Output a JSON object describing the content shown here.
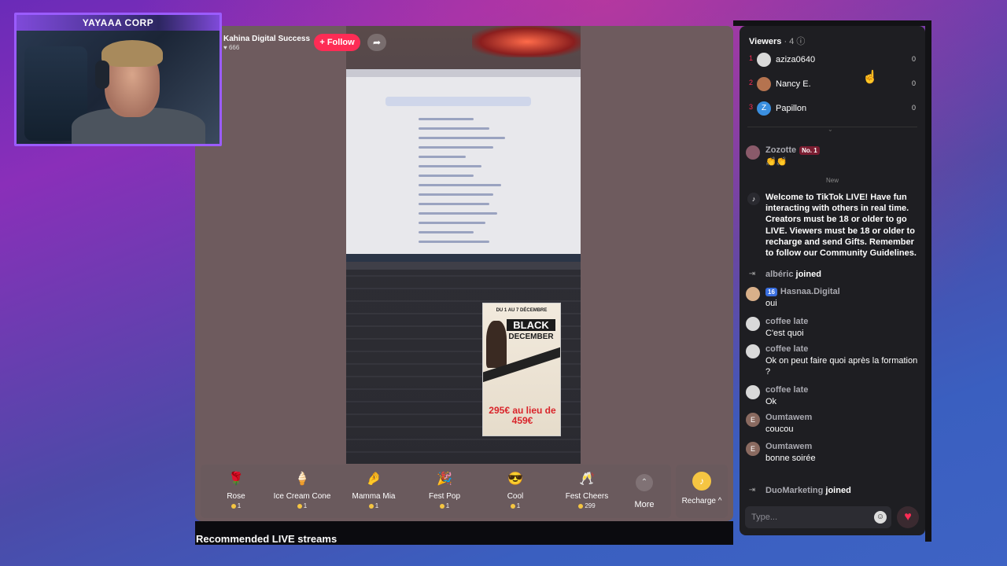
{
  "webcam": {
    "title": "YAYAAA CORP"
  },
  "streamer": {
    "name": "Kahina Digital Success",
    "likes": "666",
    "follow_label": "+ Follow",
    "share_icon": "share-icon"
  },
  "stream_poster": {
    "top": "DU 1 AU 7 DÉCEMBRE",
    "line1": "BLACK",
    "line2": "DECEMBER",
    "price": "295€ au lieu de 459€"
  },
  "gifts": [
    {
      "name": "Rose",
      "price": "1",
      "icon": "rose-icon"
    },
    {
      "name": "Ice Cream Cone",
      "price": "1",
      "icon": "ice-cream-icon"
    },
    {
      "name": "Mamma Mia",
      "price": "1",
      "icon": "mamma-mia-icon"
    },
    {
      "name": "Fest Pop",
      "price": "1",
      "icon": "fest-pop-icon"
    },
    {
      "name": "Cool",
      "price": "1",
      "icon": "sunglasses-icon"
    },
    {
      "name": "Fest Cheers",
      "price": "299",
      "icon": "fest-cheers-icon"
    }
  ],
  "more_label": "More",
  "recharge_label": "Recharge ^",
  "recommended_title": "Recommended LIVE streams",
  "viewers": {
    "title": "Viewers",
    "count": "· 4",
    "list": [
      {
        "rank": "1",
        "name": "aziza0640",
        "score": "0",
        "initial": ""
      },
      {
        "rank": "2",
        "name": "Nancy E.",
        "score": "0",
        "initial": ""
      },
      {
        "rank": "3",
        "name": "Papillon",
        "score": "0",
        "initial": "Z"
      }
    ]
  },
  "top_gifter": {
    "name": "Zozotte",
    "badge": "No. 1",
    "text": "👏👏"
  },
  "new_label": "New",
  "system_message": "Welcome to TikTok LIVE! Have fun interacting with others in real time. Creators must be 18 or older to go LIVE. Viewers must be 18 or older to recharge and send Gifts. Remember to follow our Community Guidelines.",
  "chat": [
    {
      "type": "join",
      "user": "albéric",
      "text": "joined"
    },
    {
      "type": "msg",
      "user": "Hasnaa.Digital",
      "badge": "16",
      "text": "oui"
    },
    {
      "type": "msg",
      "user": "coffee late",
      "text": "C'est quoi"
    },
    {
      "type": "msg",
      "user": "coffee late",
      "text": "Ok on peut faire quoi après la formation ?"
    },
    {
      "type": "msg",
      "user": "coffee late",
      "text": "Ok"
    },
    {
      "type": "msg",
      "user": "Oumtawem",
      "initial": "E",
      "text": "coucou"
    },
    {
      "type": "msg",
      "user": "Oumtawem",
      "initial": "E",
      "text": "bonne soirée"
    },
    {
      "type": "join",
      "user": "DuoMarketing",
      "text": "joined"
    }
  ],
  "input": {
    "placeholder": "Type..."
  },
  "colors": {
    "accent": "#fe2c55",
    "panel": "#1e1e22",
    "video_bg": "#6e5b5e"
  }
}
